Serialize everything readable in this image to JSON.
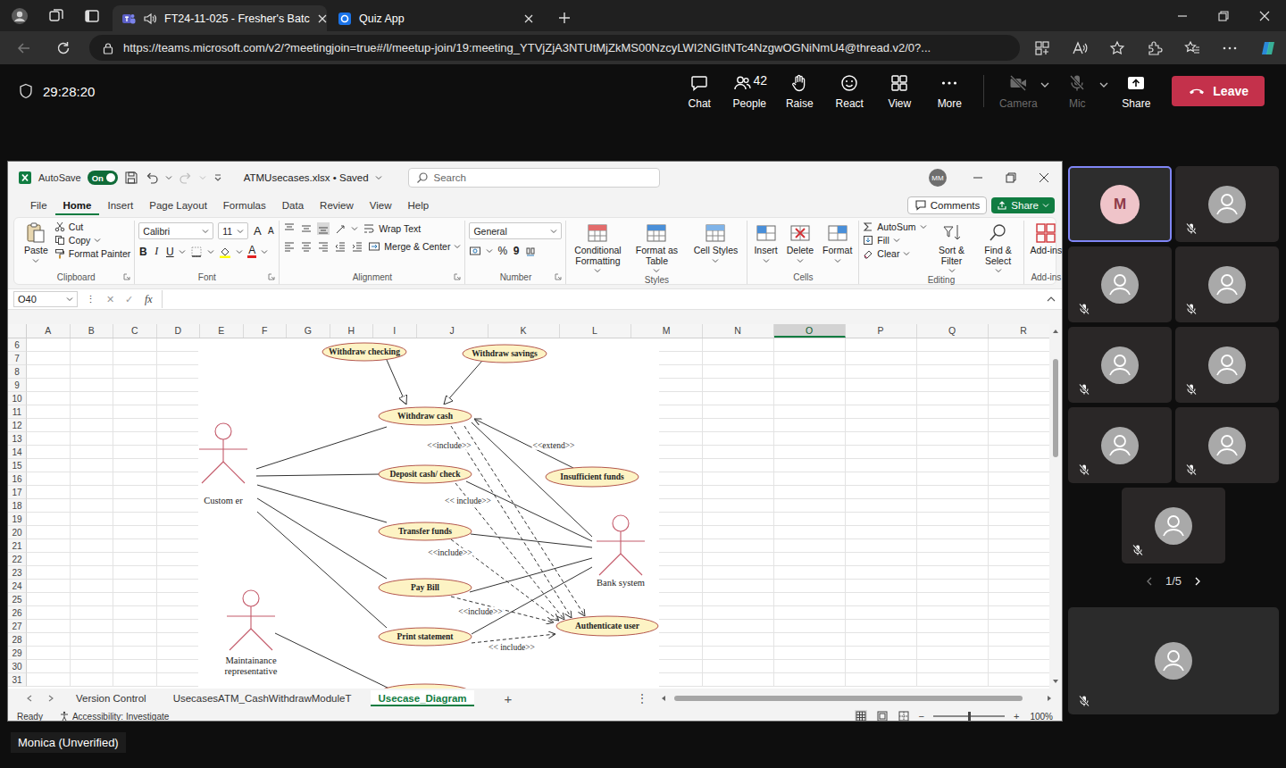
{
  "browser": {
    "tabs": [
      {
        "title": "FT24-11-025 - Fresher's Batc",
        "selected": true,
        "kind": "teams",
        "audio": true
      },
      {
        "title": "Quiz App",
        "selected": false,
        "kind": "quiz",
        "audio": false
      }
    ],
    "url": "https://teams.microsoft.com/v2/?meetingjoin=true#/l/meetup-join/19:meeting_YTVjZjA3NTUtMjZkMS00NzcyLWI2NGItNTc4NzgwOGNiNmU4@thread.v2/0?..."
  },
  "meeting": {
    "timer": "29:28:20",
    "controls": [
      {
        "label": "Chat",
        "kind": "chat"
      },
      {
        "label": "People",
        "kind": "people",
        "count": "42"
      },
      {
        "label": "Raise",
        "kind": "raise"
      },
      {
        "label": "React",
        "kind": "react"
      },
      {
        "label": "View",
        "kind": "view"
      },
      {
        "label": "More",
        "kind": "more"
      }
    ],
    "devices": [
      {
        "label": "Camera",
        "kind": "camera",
        "disabled": true
      },
      {
        "label": "Mic",
        "kind": "mic",
        "disabled": true
      }
    ],
    "share": "Share",
    "leave": "Leave"
  },
  "excel": {
    "autosave": {
      "label": "AutoSave",
      "state": "On",
      "on": true
    },
    "file": "ATMUsecases.xlsx • Saved",
    "search": "Search",
    "user": "MM",
    "menu": [
      {
        "label": "File",
        "selected": false
      },
      {
        "label": "Home",
        "selected": true
      },
      {
        "label": "Insert",
        "selected": false
      },
      {
        "label": "Page Layout",
        "selected": false
      },
      {
        "label": "Formulas",
        "selected": false
      },
      {
        "label": "Data",
        "selected": false
      },
      {
        "label": "Review",
        "selected": false
      },
      {
        "label": "View",
        "selected": false
      },
      {
        "label": "Help",
        "selected": false
      }
    ],
    "comments": "Comments",
    "share": "Share",
    "ribbon": {
      "clipboard": {
        "paste": "Paste",
        "cut": "Cut",
        "copy": "Copy",
        "format_painter": "Format Painter",
        "label": "Clipboard"
      },
      "font": {
        "name": "Calibri",
        "size": "11",
        "grow": "A",
        "shrink": "A",
        "bold": "B",
        "italic": "I",
        "underline": "U",
        "color": "A",
        "label": "Font"
      },
      "alignment": {
        "wrap": "Wrap Text",
        "merge": "Merge & Center",
        "label": "Alignment"
      },
      "number": {
        "format": "General",
        "percent": "%",
        "comma": "9",
        "label": "Number"
      },
      "styles": {
        "items": [
          "Conditional Formatting",
          "Format as Table",
          "Cell Styles"
        ],
        "label": "Styles"
      },
      "cells": {
        "items": [
          "Insert",
          "Delete",
          "Format"
        ],
        "label": "Cells"
      },
      "editing": {
        "autosum": "AutoSum",
        "fill": "Fill",
        "clear": "Clear",
        "sort": "Sort & Filter",
        "find": "Find & Select",
        "label": "Editing"
      },
      "addins": {
        "button": "Add-ins",
        "label": "Add-ins"
      }
    },
    "name_box": "O40",
    "formula": {
      "more": "⋮",
      "cancel": "✕",
      "enter": "✓",
      "fx": "fx"
    },
    "columns": [
      {
        "label": "A",
        "selected": false
      },
      {
        "label": "B",
        "selected": false
      },
      {
        "label": "C",
        "selected": false
      },
      {
        "label": "D",
        "selected": false
      },
      {
        "label": "E",
        "selected": false
      },
      {
        "label": "F",
        "selected": false
      },
      {
        "label": "G",
        "selected": false
      },
      {
        "label": "H",
        "selected": false
      },
      {
        "label": "I",
        "selected": false
      },
      {
        "label": "J",
        "selected": false
      },
      {
        "label": "K",
        "selected": false
      },
      {
        "label": "L",
        "selected": false
      },
      {
        "label": "M",
        "selected": false
      },
      {
        "label": "N",
        "selected": false
      },
      {
        "label": "O",
        "selected": true
      },
      {
        "label": "P",
        "selected": false
      },
      {
        "label": "Q",
        "selected": false
      },
      {
        "label": "R",
        "selected": false
      }
    ],
    "rows": [
      "6",
      "7",
      "8",
      "9",
      "10",
      "11",
      "12",
      "13",
      "14",
      "15",
      "16",
      "17",
      "18",
      "19",
      "20",
      "21",
      "22",
      "23",
      "24",
      "25",
      "26",
      "27",
      "28",
      "29",
      "30",
      "31"
    ],
    "sheets": [
      {
        "label": "Version Control",
        "selected": false
      },
      {
        "label": "UsecasesATM_CashWithdrawModuleT",
        "selected": false
      },
      {
        "label": "Usecase_Diagram",
        "selected": true
      }
    ],
    "add_sheet": "+",
    "sheet_more": "⋮",
    "status": {
      "ready": "Ready",
      "accessibility": "Accessibility: Investigate",
      "zoom_out": "−",
      "zoom_in": "+",
      "zoom": "100%",
      "zoom_level": 0.5
    }
  },
  "diagram": {
    "use_cases": [
      {
        "name": "Withdraw checking"
      },
      {
        "name": "Withdraw savings"
      },
      {
        "name": "Withdraw cash"
      },
      {
        "name": "Deposit cash/ check"
      },
      {
        "name": "Insufficient funds"
      },
      {
        "name": "Transfer funds"
      },
      {
        "name": "Pay Bill"
      },
      {
        "name": "Print statement"
      },
      {
        "name": "Authenticate user"
      }
    ],
    "actors": [
      {
        "name": "Custom er"
      },
      {
        "name": "Bank system"
      },
      {
        "name": "Maintainance representative"
      }
    ],
    "relations": [
      {
        "label": "<<include>>",
        "kind": "include"
      },
      {
        "label": "<<extend>>",
        "kind": "extend"
      },
      {
        "label": "<< include>>",
        "kind": "include"
      },
      {
        "label": "<<include>>",
        "kind": "include"
      },
      {
        "label": "<<include>>",
        "kind": "include"
      },
      {
        "label": "<< include>>",
        "kind": "include"
      }
    ]
  },
  "participants": {
    "tiles": [
      {
        "kind": "initial",
        "initial": "M",
        "selected": true,
        "muted": false
      },
      {
        "kind": "avatar",
        "selected": false,
        "muted": true
      },
      {
        "kind": "avatar",
        "selected": false,
        "muted": true
      },
      {
        "kind": "avatar",
        "selected": false,
        "muted": true
      },
      {
        "kind": "avatar",
        "selected": false,
        "muted": true
      },
      {
        "kind": "avatar",
        "selected": false,
        "muted": true
      },
      {
        "kind": "avatar",
        "selected": false,
        "muted": true
      },
      {
        "kind": "avatar",
        "selected": false,
        "muted": true
      },
      {
        "kind": "avatar",
        "selected": false,
        "muted": true
      }
    ],
    "page": "1/5",
    "pinned": {
      "muted": true
    }
  },
  "presenter": "Monica (Unverified)"
}
